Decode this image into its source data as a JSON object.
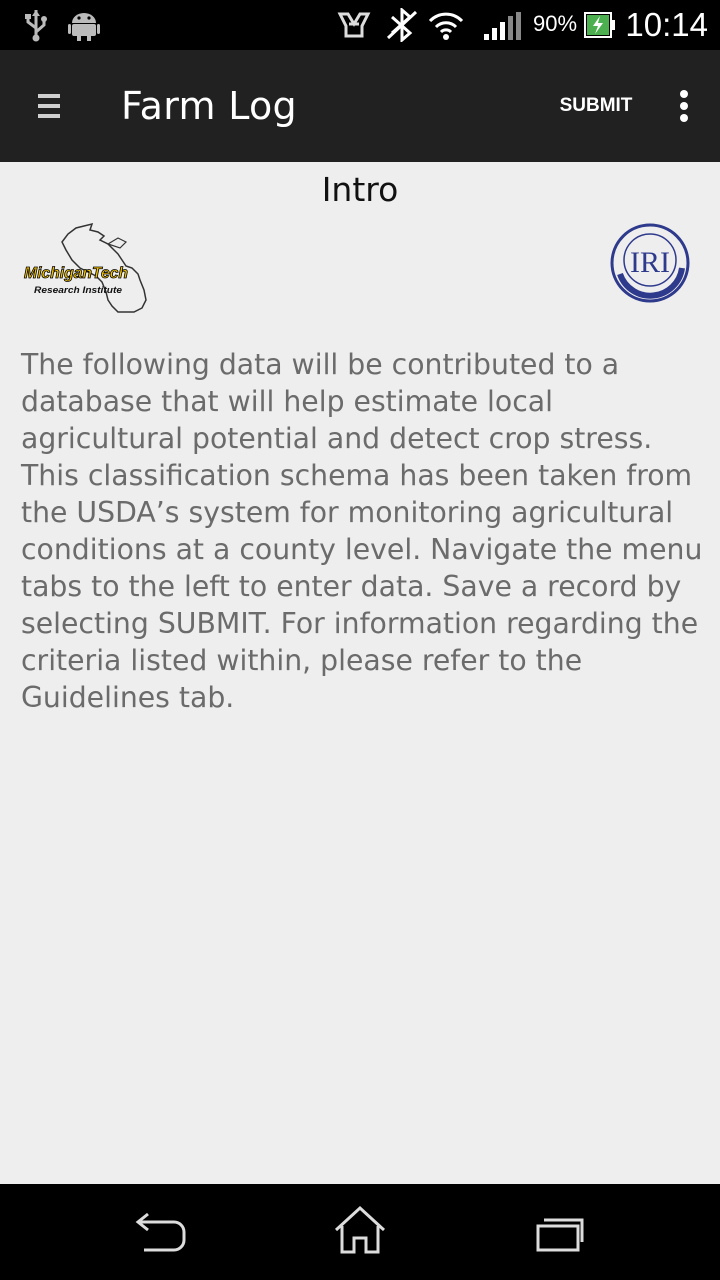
{
  "status_bar": {
    "battery_percent": "90%",
    "time": "10:14",
    "icons": [
      "usb-icon",
      "android-debug-icon",
      "nfc-icon",
      "bluetooth-icon",
      "wifi-icon",
      "signal-icon",
      "battery-charging-icon"
    ]
  },
  "app_bar": {
    "title": "Farm Log",
    "submit_label": "SUBMIT",
    "menu_icon": "hamburger-menu-icon",
    "overflow_icon": "more-vert-icon"
  },
  "content": {
    "heading": "Intro",
    "logo_left": {
      "line1": "MichiganTech",
      "line2": "Research Institute"
    },
    "logo_right": {
      "text": "IRI"
    },
    "body": "The following data will be contributed to a database that will help estimate local agricultural potential and detect crop stress. This classification schema has been taken from the USDA’s system for monitoring agricultural conditions at a county level. Navigate the menu tabs to the left to enter data. Save a record by selecting SUBMIT. For information regarding the criteria listed within, please refer to the Guidelines tab."
  },
  "nav_bar": {
    "buttons": [
      "back-icon",
      "home-icon",
      "recent-apps-icon"
    ]
  },
  "colors": {
    "app_bar": "#212121",
    "background": "#eeeeee",
    "body_text": "#6b6b6b",
    "iri_blue": "#2e3a8c",
    "mtri_gold": "#f5c400"
  }
}
